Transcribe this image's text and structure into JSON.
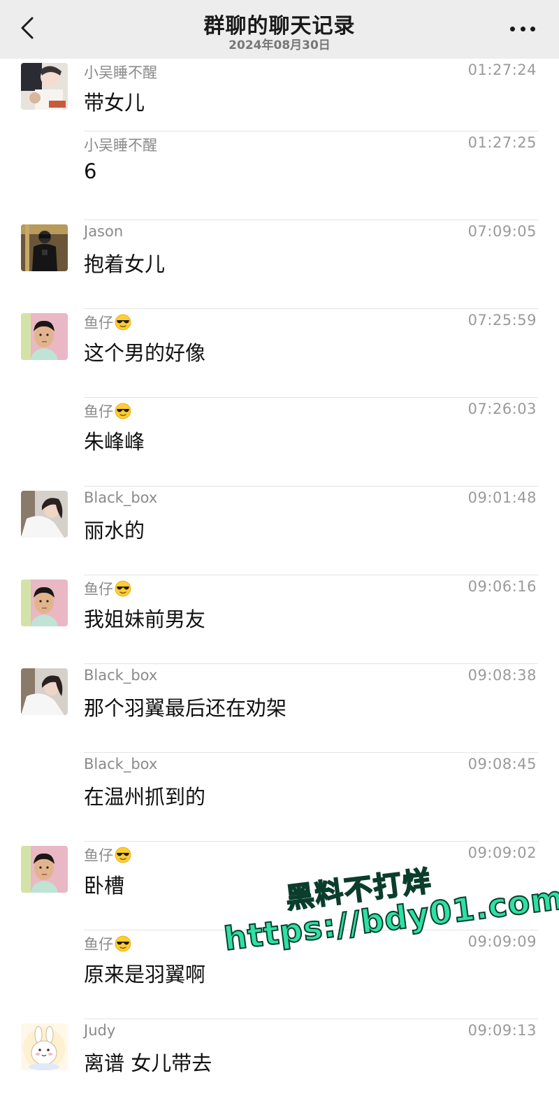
{
  "header": {
    "title": "群聊的聊天记录",
    "date": "2024年08月30日"
  },
  "messages": [
    {
      "name": "小吴睡不醒",
      "time": "01:27:24",
      "text": "带女儿",
      "avatar": "avatar-photo-eating",
      "show_avatar": true,
      "emoji": ""
    },
    {
      "name": "小吴睡不醒",
      "time": "01:27:25",
      "text": "6",
      "avatar": "",
      "show_avatar": false,
      "emoji": ""
    },
    {
      "name": "Jason",
      "time": "07:09:05",
      "text": "抱着女儿",
      "avatar": "avatar-photo-dark-jacket",
      "show_avatar": true,
      "emoji": ""
    },
    {
      "name": "鱼仔",
      "time": "07:25:59",
      "text": "这个男的好像",
      "avatar": "avatar-photo-boy-portrait",
      "show_avatar": true,
      "emoji": "sunglasses-emoji"
    },
    {
      "name": "鱼仔",
      "time": "07:26:03",
      "text": "朱峰峰",
      "avatar": "",
      "show_avatar": false,
      "emoji": "sunglasses-emoji"
    },
    {
      "name": "Black_box",
      "time": "09:01:48",
      "text": "丽水的",
      "avatar": "avatar-photo-girl-white",
      "show_avatar": true,
      "emoji": ""
    },
    {
      "name": "鱼仔",
      "time": "09:06:16",
      "text": "我姐妹前男友",
      "avatar": "avatar-photo-boy-portrait",
      "show_avatar": true,
      "emoji": "sunglasses-emoji"
    },
    {
      "name": "Black_box",
      "time": "09:08:38",
      "text": "那个羽翼最后还在劝架",
      "avatar": "avatar-photo-girl-white",
      "show_avatar": true,
      "emoji": ""
    },
    {
      "name": "Black_box",
      "time": "09:08:45",
      "text": "在温州抓到的",
      "avatar": "",
      "show_avatar": false,
      "emoji": ""
    },
    {
      "name": "鱼仔",
      "time": "09:09:02",
      "text": "卧槽",
      "avatar": "avatar-photo-boy-portrait",
      "show_avatar": true,
      "emoji": "sunglasses-emoji"
    },
    {
      "name": "鱼仔",
      "time": "09:09:09",
      "text": "原来是羽翼啊",
      "avatar": "",
      "show_avatar": false,
      "emoji": "sunglasses-emoji"
    },
    {
      "name": "Judy",
      "time": "09:09:13",
      "text": "离谱  女儿带去",
      "avatar": "avatar-cartoon-bunny",
      "show_avatar": true,
      "emoji": ""
    }
  ],
  "watermark": {
    "line1": "黑料不打烊",
    "line2": "https://bdy01.com"
  },
  "colors": {
    "header_bg": "#ededed",
    "name_gray": "#8a8a8a",
    "watermark_green": "#2fe0a5"
  }
}
